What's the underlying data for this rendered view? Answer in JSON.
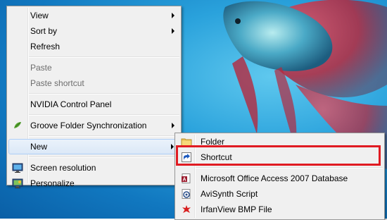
{
  "main_menu": {
    "items": [
      {
        "label": "View",
        "submenu": true
      },
      {
        "label": "Sort by",
        "submenu": true
      },
      {
        "label": "Refresh"
      },
      {
        "label": "Paste",
        "disabled": true
      },
      {
        "label": "Paste shortcut",
        "disabled": true
      },
      {
        "label": "NVIDIA Control Panel"
      },
      {
        "label": "Groove Folder Synchronization",
        "submenu": true,
        "icon": "groove-icon"
      },
      {
        "label": "New",
        "submenu": true,
        "highlighted": true
      },
      {
        "label": "Screen resolution",
        "icon": "screen-resolution-icon"
      },
      {
        "label": "Personalize",
        "icon": "personalize-icon"
      }
    ]
  },
  "new_submenu": {
    "items": [
      {
        "label": "Folder",
        "icon": "folder-icon"
      },
      {
        "label": "Shortcut",
        "icon": "shortcut-icon",
        "highlighted": true
      },
      {
        "label": "Microsoft Office Access 2007 Database",
        "icon": "access-icon"
      },
      {
        "label": "AviSynth Script",
        "icon": "avisynth-icon"
      },
      {
        "label": "IrfanView BMP File",
        "icon": "irfanview-icon"
      }
    ]
  },
  "colors": {
    "desktop_blue": "#1e8fd6",
    "highlight_box": "#e01b22",
    "menu_bg": "#f0f0f0"
  }
}
